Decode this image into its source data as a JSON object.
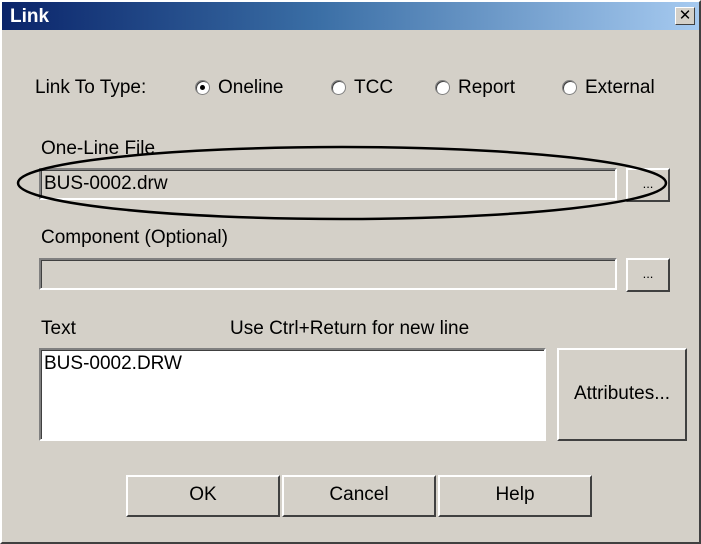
{
  "window": {
    "title": "Link",
    "close_glyph": "✕"
  },
  "link_type": {
    "label": "Link To Type:",
    "options": [
      {
        "label": "Oneline",
        "selected": true
      },
      {
        "label": "TCC",
        "selected": false
      },
      {
        "label": "Report",
        "selected": false
      },
      {
        "label": "External",
        "selected": false
      }
    ]
  },
  "oneline_file": {
    "label": "One-Line File",
    "value": "BUS-0002.drw",
    "browse_label": "..."
  },
  "component": {
    "label": "Component (Optional)",
    "value": "",
    "browse_label": "..."
  },
  "text": {
    "label": "Text",
    "hint": "Use Ctrl+Return for new line",
    "value": "BUS-0002.DRW",
    "attributes_label": "Attributes..."
  },
  "buttons": {
    "ok": "OK",
    "cancel": "Cancel",
    "help": "Help"
  },
  "colors": {
    "dialog_bg": "#d4d0c8",
    "title_start": "#0a246a",
    "title_end": "#a6caf0"
  }
}
